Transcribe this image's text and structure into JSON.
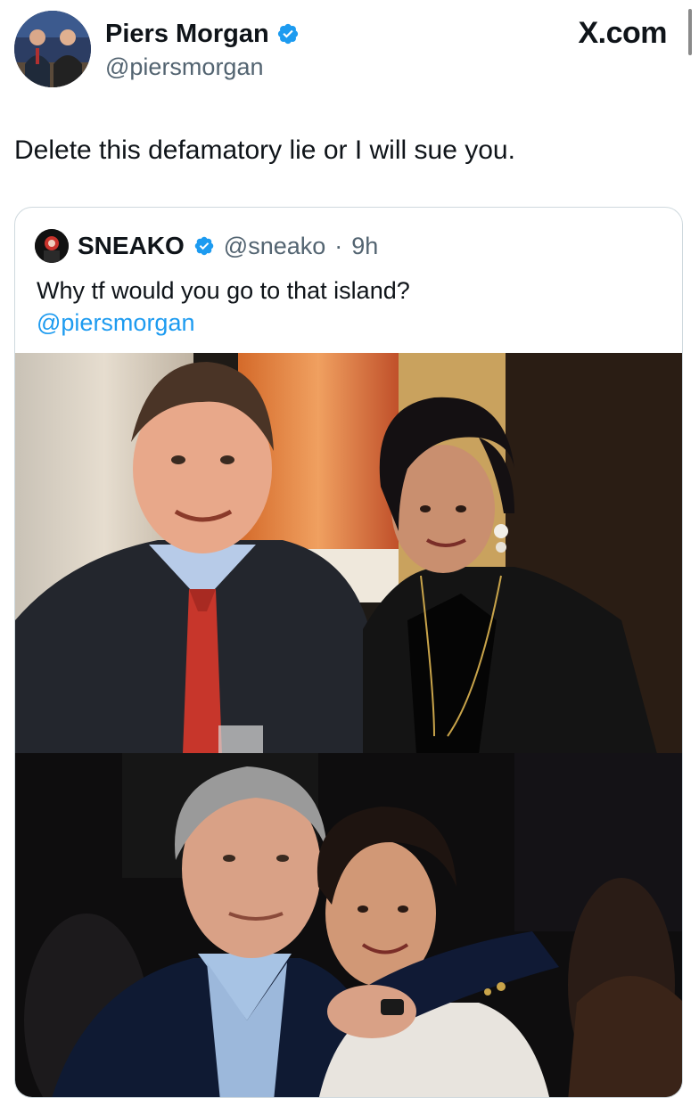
{
  "author": {
    "name": "Piers Morgan",
    "handle": "@piersmorgan",
    "verified": true
  },
  "site": {
    "label": "X.com"
  },
  "tweet": {
    "text": "Delete this defamatory lie or I will sue you."
  },
  "quoted": {
    "name": "SNEAKO",
    "handle": "@sneako",
    "separator": "·",
    "time": "9h",
    "text": "Why tf would you go to that island?",
    "mention": "@piersmorgan",
    "verified": true
  },
  "colors": {
    "verified": "#1d9bf0",
    "link": "#1d9bf0",
    "secondary_text": "#536471",
    "border": "#cfd9de"
  },
  "icons": {
    "verified": "verified-badge-icon"
  }
}
